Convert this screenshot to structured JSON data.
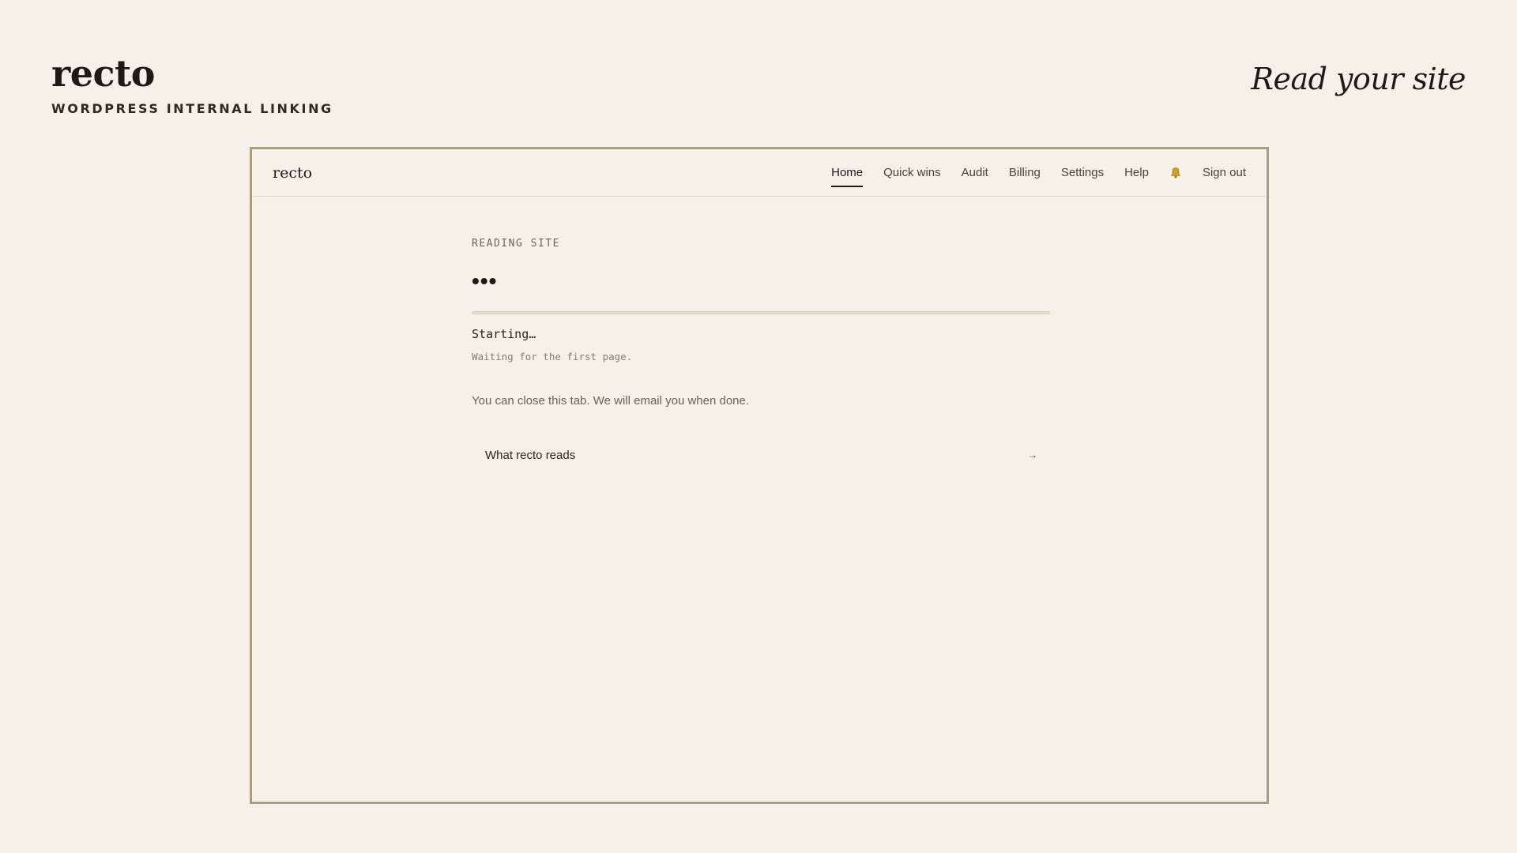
{
  "header": {
    "brand_name": "recto",
    "tagline": "WORDPRESS INTERNAL LINKING",
    "slogan": "Read your site"
  },
  "app": {
    "logo": "recto",
    "nav": {
      "home": "Home",
      "quick_wins": "Quick wins",
      "audit": "Audit",
      "billing": "Billing",
      "settings": "Settings",
      "help": "Help",
      "notifications_icon": "bell-icon",
      "sign_out": "Sign out"
    },
    "active_tab": "Home"
  },
  "main": {
    "eyebrow": "READING SITE",
    "loading_indicator": "•••",
    "progress_fraction": 0,
    "status": "Starting…",
    "substatus": "Waiting for the first page.",
    "note": "You can close this tab. We will email you when done.",
    "link_label": "What recto reads",
    "link_icon": "arrow-right-icon",
    "link_arrow": "→"
  },
  "colors": {
    "background": "#f5f0e8",
    "frame_border": "#a69f82",
    "bell": "#c9a227"
  }
}
